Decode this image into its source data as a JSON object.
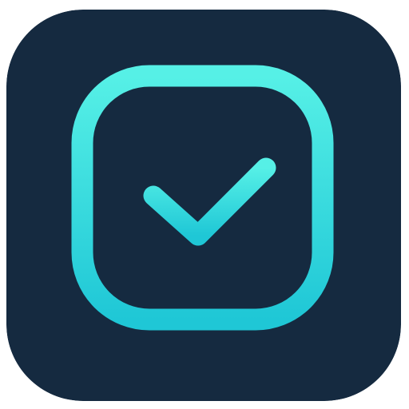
{
  "icon": {
    "name": "checkbox-checked",
    "background_color": "#152a40",
    "gradient_top": "#56f0e6",
    "gradient_bottom": "#1fc7d6"
  }
}
